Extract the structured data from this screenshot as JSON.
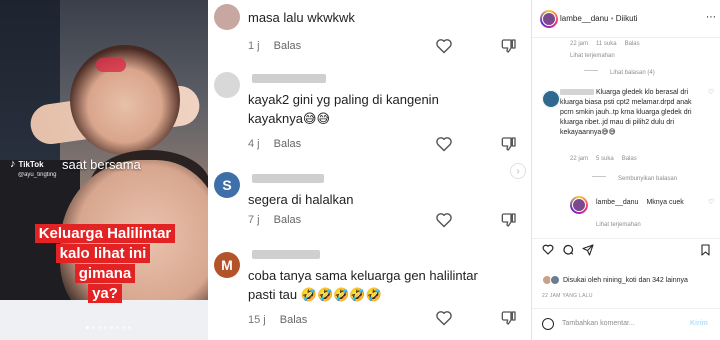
{
  "video": {
    "app_logo": "TikTok",
    "caption": "saat bersama",
    "handle": "@ayu_tingting",
    "overlay_line1": "Keluarga Halilintar",
    "overlay_line2": "kalo lihat ini gimana",
    "overlay_line3": "ya?",
    "accent_color": "#e32224"
  },
  "comments": [
    {
      "avatar_letter": "",
      "avatar_color": "#c7a7a0",
      "text_lines": [
        "masa lalu wkwkwk"
      ],
      "time": "1 j",
      "reply": "Balas"
    },
    {
      "avatar_letter": "",
      "avatar_color": "#d8d8d8",
      "text_lines": [
        "kayak2 gini yg paling di kangenin",
        "kayaknya😅😅"
      ],
      "time": "4 j",
      "reply": "Balas"
    },
    {
      "avatar_letter": "S",
      "avatar_color": "#3f6fa8",
      "text_lines": [
        "segera di halalkan"
      ],
      "time": "7 j",
      "reply": "Balas"
    },
    {
      "avatar_letter": "M",
      "avatar_color": "#b4532a",
      "text_lines": [
        "coba tanya sama keluarga gen halilintar",
        "pasti tau 🤣🤣🤣🤣🤣"
      ],
      "time": "15 j",
      "reply": "Balas"
    }
  ],
  "instagram": {
    "account": "lambe__danu",
    "follow_status": "Diikuti",
    "c1_time": "22 jam",
    "c1_likes": "11 suka",
    "c1_reply": "Balas",
    "c1_translate": "Lihat terjemahan",
    "c1_view_replies": "Lihat balasan (4)",
    "c2_text": "Kluarga gledek klo berasal dri kluarga biasa psti cpt2 melamar.drpd anak pcrn smkin jauh..tp krna kluarga gledek dri kluarga ribet..jd mau di pilih2 dulu dri kekayaannya😅😅",
    "c2_time": "22 jam",
    "c2_likes": "5 suka",
    "c2_reply": "Balas",
    "hide_replies": "Sembunyikan balasan",
    "reply_user": "lambe__danu",
    "reply_text": "Mknya cuek",
    "reply_translate": "Lihat terjemahan",
    "likes_text": "Disukai oleh nining_koti dan 342 lainnya",
    "timestamp": "22 JAM YANG LALU",
    "add_comment_placeholder": "Tambahkan komentar...",
    "send_label": "Kirim"
  }
}
